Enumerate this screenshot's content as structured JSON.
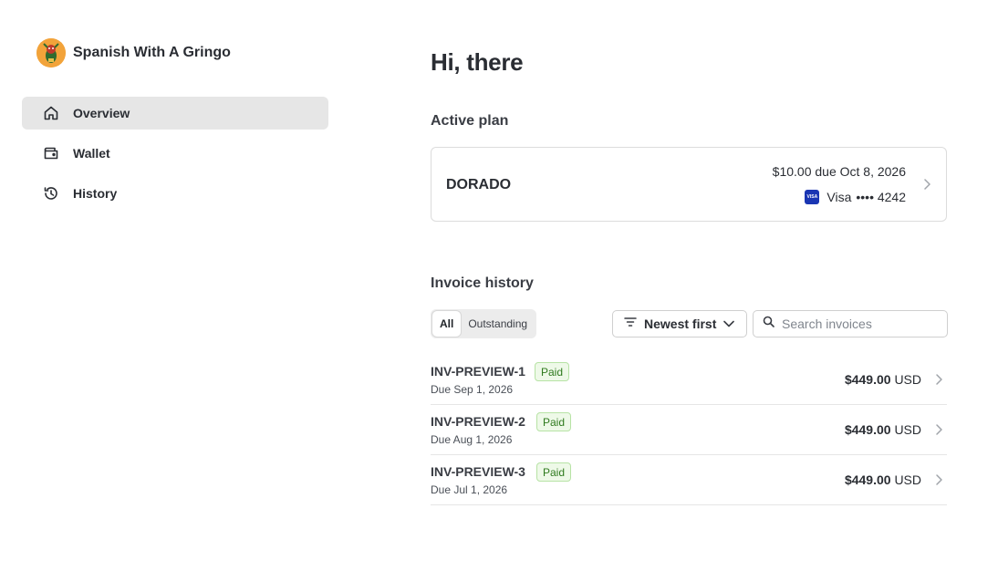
{
  "brand": {
    "name": "Spanish With A Gringo"
  },
  "sidebar": {
    "items": [
      {
        "label": "Overview",
        "icon": "home-icon",
        "active": true
      },
      {
        "label": "Wallet",
        "icon": "wallet-icon",
        "active": false
      },
      {
        "label": "History",
        "icon": "history-icon",
        "active": false
      }
    ]
  },
  "main": {
    "greeting": "Hi, there",
    "active_plan": {
      "title": "Active plan",
      "name": "DORADO",
      "due": "$10.00 due Oct 8, 2026",
      "card_brand": "Visa",
      "card_mask": "•••• 4242",
      "card_badge": "VISA"
    },
    "invoice_history": {
      "title": "Invoice history",
      "filters": [
        {
          "label": "All",
          "active": true
        },
        {
          "label": "Outstanding",
          "active": false
        }
      ],
      "sort_label": "Newest first",
      "search_placeholder": "Search invoices",
      "invoices": [
        {
          "id": "INV-PREVIEW-1",
          "status": "Paid",
          "due": "Due Sep 1, 2026",
          "amount": "$449.00",
          "currency": "USD"
        },
        {
          "id": "INV-PREVIEW-2",
          "status": "Paid",
          "due": "Due Aug 1, 2026",
          "amount": "$449.00",
          "currency": "USD"
        },
        {
          "id": "INV-PREVIEW-3",
          "status": "Paid",
          "due": "Due Jul 1, 2026",
          "amount": "$449.00",
          "currency": "USD"
        }
      ]
    }
  },
  "colors": {
    "active_nav_bg": "#e6e6e6",
    "paid_badge_bg": "#eef9e8",
    "paid_badge_text": "#2f7a1e",
    "visa_blue": "#1a36b3",
    "logo_orange": "#f2a33a"
  }
}
